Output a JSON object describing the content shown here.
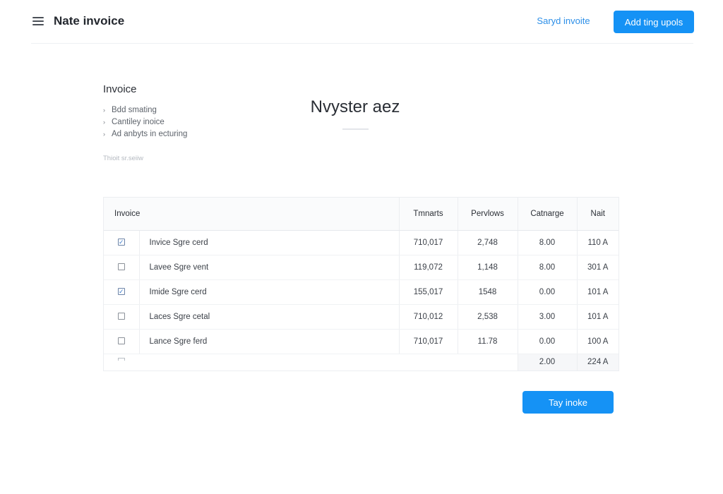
{
  "header": {
    "title": "Nate invoice",
    "link_label": "Saryd invoite",
    "primary_label": "Add ting upols"
  },
  "intro": {
    "heading": "Invoice",
    "features": [
      {
        "icon": "chevron-right-icon",
        "label": "Bdd smating"
      },
      {
        "icon": "chevron-right-icon",
        "label": "Cantiley inoice"
      },
      {
        "icon": "chevron-right-icon",
        "label": "Ad anbyts in ecturing"
      }
    ],
    "note": "Thioit sr.seiiw"
  },
  "main": {
    "title": "Nvyster aez"
  },
  "table": {
    "columns": [
      "Invoice",
      "Tmnarts",
      "Pervlows",
      "Catnarge",
      "Nait"
    ],
    "rows": [
      {
        "checked": true,
        "name": "Invice Sgre cerd",
        "tmnarts": "710,017",
        "pervlows": "2,748",
        "catnarge": "8.00",
        "nait": "110 A"
      },
      {
        "checked": false,
        "name": "Lavee Sgre vent",
        "tmnarts": "119,072",
        "pervlows": "1,148",
        "catnarge": "8.00",
        "nait": "301 A"
      },
      {
        "checked": true,
        "name": "Imide Sgre cerd",
        "tmnarts": "155,017",
        "pervlows": "1548",
        "catnarge": "0.00",
        "nait": "101 A"
      },
      {
        "checked": false,
        "name": "Laces Sgre cetal",
        "tmnarts": "710,012",
        "pervlows": "2,538",
        "catnarge": "3.00",
        "nait": "101 A"
      },
      {
        "checked": false,
        "name": "Lance Sgre ferd",
        "tmnarts": "710,017",
        "pervlows": "11.78",
        "catnarge": "0.00",
        "nait": "100 A"
      }
    ],
    "summary": {
      "catnarge": "2.00",
      "nait": "224 A"
    }
  },
  "footer": {
    "primary_label": "Tay inoke"
  },
  "colors": {
    "accent": "#1592f5",
    "link": "#2c8fe8"
  }
}
